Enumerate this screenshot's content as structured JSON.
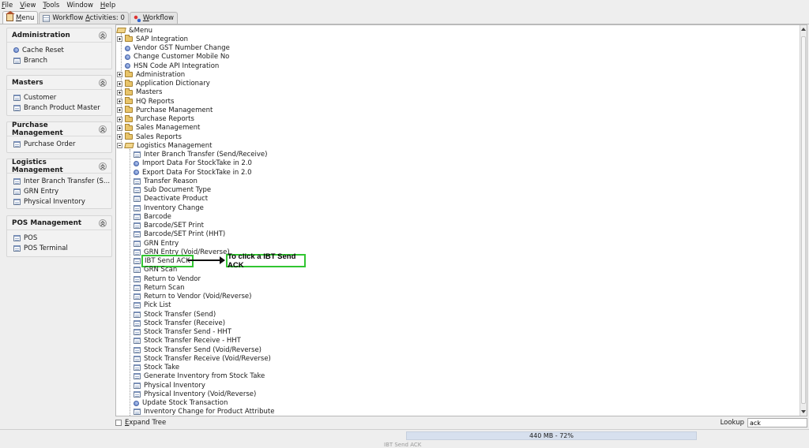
{
  "menubar": [
    {
      "pre": "",
      "u": "F",
      "post": "ile"
    },
    {
      "pre": "",
      "u": "V",
      "post": "iew"
    },
    {
      "pre": "",
      "u": "T",
      "post": "ools"
    },
    {
      "pre": "",
      "u": "",
      "post": "Window"
    },
    {
      "pre": "",
      "u": "H",
      "post": "elp"
    }
  ],
  "tabs": [
    {
      "icon": "home-icon",
      "pre": "",
      "u": "M",
      "post": "enu"
    },
    {
      "icon": "list-icon",
      "pre": "Workflow ",
      "u": "A",
      "post": "ctivities: 0"
    },
    {
      "icon": "workflow-icon",
      "pre": "",
      "u": "W",
      "post": "orkflow"
    }
  ],
  "sidebar": {
    "panels": [
      {
        "title": "Administration",
        "items": [
          {
            "icon": "process",
            "label": "Cache Reset"
          },
          {
            "icon": "window",
            "label": "Branch"
          }
        ]
      },
      {
        "title": "Masters",
        "items": [
          {
            "icon": "window",
            "label": "Customer"
          },
          {
            "icon": "window",
            "label": "Branch Product Master"
          }
        ]
      },
      {
        "title": "Purchase Management",
        "items": [
          {
            "icon": "window",
            "label": "Purchase Order"
          }
        ]
      },
      {
        "title": "Logistics Management",
        "items": [
          {
            "icon": "window",
            "label": "Inter Branch Transfer (S..."
          },
          {
            "icon": "window",
            "label": "GRN Entry"
          },
          {
            "icon": "window",
            "label": "Physical Inventory"
          }
        ]
      },
      {
        "title": "POS Management",
        "items": [
          {
            "icon": "window",
            "label": "POS"
          },
          {
            "icon": "window",
            "label": "POS Terminal"
          }
        ]
      }
    ]
  },
  "tree": {
    "root": "&Menu",
    "rows": [
      {
        "level": 1,
        "type": "folder",
        "label": "SAP Integration"
      },
      {
        "level": 1,
        "type": "process",
        "label": "Vendor GST Number Change"
      },
      {
        "level": 1,
        "type": "process",
        "label": "Change Customer Mobile No"
      },
      {
        "level": 1,
        "type": "process",
        "label": "HSN Code API Integration"
      },
      {
        "level": 1,
        "type": "folder",
        "label": "Administration"
      },
      {
        "level": 1,
        "type": "folder",
        "label": "Application Dictionary"
      },
      {
        "level": 1,
        "type": "folder",
        "label": "Masters"
      },
      {
        "level": 1,
        "type": "folder",
        "label": "HQ Reports"
      },
      {
        "level": 1,
        "type": "folder",
        "label": "Purchase Management"
      },
      {
        "level": 1,
        "type": "folder",
        "label": "Purchase Reports"
      },
      {
        "level": 1,
        "type": "folder",
        "label": "Sales Management"
      },
      {
        "level": 1,
        "type": "folder",
        "label": "Sales Reports"
      },
      {
        "level": 1,
        "type": "folder-open",
        "label": "Logistics Management"
      },
      {
        "level": 2,
        "type": "window",
        "label": "Inter Branch Transfer (Send/Receive)"
      },
      {
        "level": 2,
        "type": "process",
        "label": "Import Data For StockTake in 2.0"
      },
      {
        "level": 2,
        "type": "process",
        "label": "Export Data For StockTake in 2.0"
      },
      {
        "level": 2,
        "type": "window",
        "label": "Transfer Reason"
      },
      {
        "level": 2,
        "type": "window",
        "label": "Sub Document Type"
      },
      {
        "level": 2,
        "type": "window",
        "label": "Deactivate Product"
      },
      {
        "level": 2,
        "type": "window",
        "label": "Inventory Change"
      },
      {
        "level": 2,
        "type": "window",
        "label": "Barcode"
      },
      {
        "level": 2,
        "type": "window",
        "label": "Barcode/SET Print"
      },
      {
        "level": 2,
        "type": "window",
        "label": "Barcode/SET Print (HHT)"
      },
      {
        "level": 2,
        "type": "window",
        "label": "GRN Entry"
      },
      {
        "level": 2,
        "type": "window",
        "label": "GRN Entry (Void/Reverse)"
      },
      {
        "level": 2,
        "type": "window",
        "label": "IBT Send ACK",
        "highlight": true
      },
      {
        "level": 2,
        "type": "window",
        "label": "GRN Scan"
      },
      {
        "level": 2,
        "type": "window",
        "label": "Return to Vendor"
      },
      {
        "level": 2,
        "type": "window",
        "label": "Return Scan"
      },
      {
        "level": 2,
        "type": "window",
        "label": "Return to Vendor (Void/Reverse)"
      },
      {
        "level": 2,
        "type": "window",
        "label": "Pick List"
      },
      {
        "level": 2,
        "type": "window",
        "label": "Stock Transfer (Send)"
      },
      {
        "level": 2,
        "type": "window",
        "label": "Stock Transfer (Receive)"
      },
      {
        "level": 2,
        "type": "window",
        "label": "Stock Transfer Send - HHT"
      },
      {
        "level": 2,
        "type": "window",
        "label": "Stock Transfer Receive - HHT"
      },
      {
        "level": 2,
        "type": "window",
        "label": "Stock Transfer Send (Void/Reverse)"
      },
      {
        "level": 2,
        "type": "window",
        "label": "Stock Transfer Receive (Void/Reverse)"
      },
      {
        "level": 2,
        "type": "window",
        "label": "Stock Take"
      },
      {
        "level": 2,
        "type": "window",
        "label": "Generate Inventory from Stock Take"
      },
      {
        "level": 2,
        "type": "window",
        "label": "Physical Inventory"
      },
      {
        "level": 2,
        "type": "window",
        "label": "Physical Inventory (Void/Reverse)"
      },
      {
        "level": 2,
        "type": "process",
        "label": "Update Stock Transaction"
      },
      {
        "level": 2,
        "type": "window",
        "label": "Inventory Change for Product Attribute"
      }
    ]
  },
  "annotation": {
    "text": "To click a IBT Send ACK",
    "color": "#31c531"
  },
  "bottom": {
    "expand_tree_pre": "",
    "expand_tree_u": "E",
    "expand_tree_post": "xpand Tree",
    "lookup_label": "Lookup",
    "lookup_value": "ack"
  },
  "status": {
    "memory": "440 MB - 72%",
    "message": "IBT Send ACK"
  }
}
